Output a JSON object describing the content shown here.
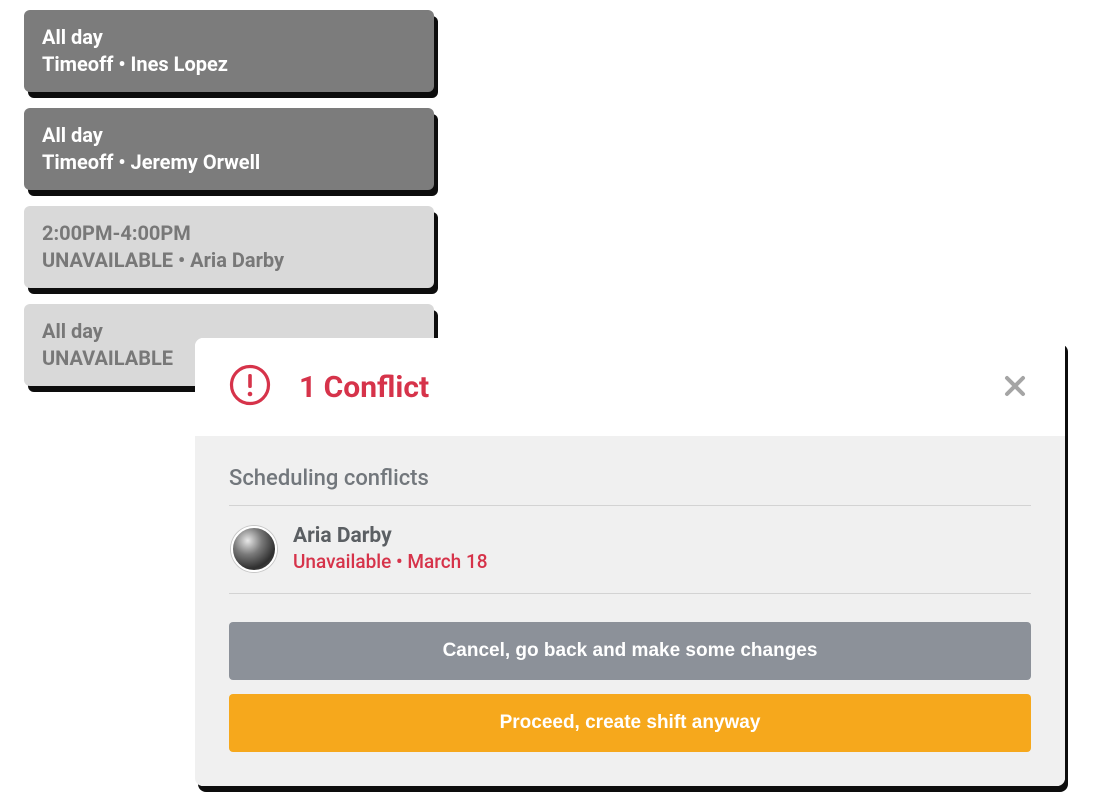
{
  "cards": [
    {
      "variant": "dark",
      "line1": "All day",
      "line2": "Timeoff • Ines Lopez"
    },
    {
      "variant": "dark",
      "line1": "All day",
      "line2": "Timeoff • Jeremy Orwell"
    },
    {
      "variant": "light",
      "line1": "2:00PM-4:00PM",
      "line2": "UNAVAILABLE • Aria Darby"
    },
    {
      "variant": "light",
      "line1": "All day",
      "line2": "UNAVAILABLE"
    }
  ],
  "modal": {
    "title": "1 Conflict",
    "section_heading": "Scheduling conflicts",
    "conflict": {
      "name": "Aria Darby",
      "detail": "Unavailable • March 18"
    },
    "cancel_label": "Cancel, go back and make some changes",
    "proceed_label": "Proceed, create shift anyway"
  },
  "colors": {
    "danger": "#d6334a",
    "primary": "#f6a81c",
    "secondary": "#8c9199"
  }
}
